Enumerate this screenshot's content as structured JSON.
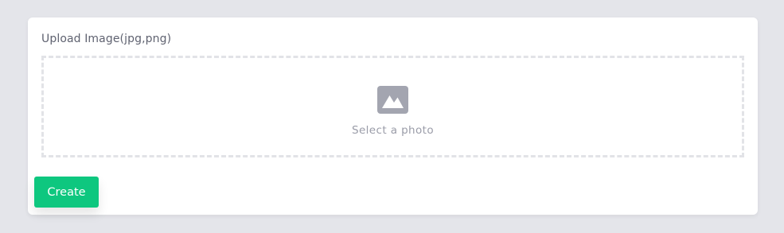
{
  "upload": {
    "label": "Upload Image(jpg,png)",
    "dropzone_text": "Select a photo",
    "dropzone_icon": "image-icon"
  },
  "actions": {
    "create_label": "Create"
  },
  "colors": {
    "page_background": "#e4e5ea",
    "card_background": "#ffffff",
    "accent_button": "#0ec77f",
    "icon": "#a3a5b0",
    "dropzone_border": "#e2e3e7",
    "label_text": "#5f6270",
    "muted_text": "#9a9ca8"
  }
}
